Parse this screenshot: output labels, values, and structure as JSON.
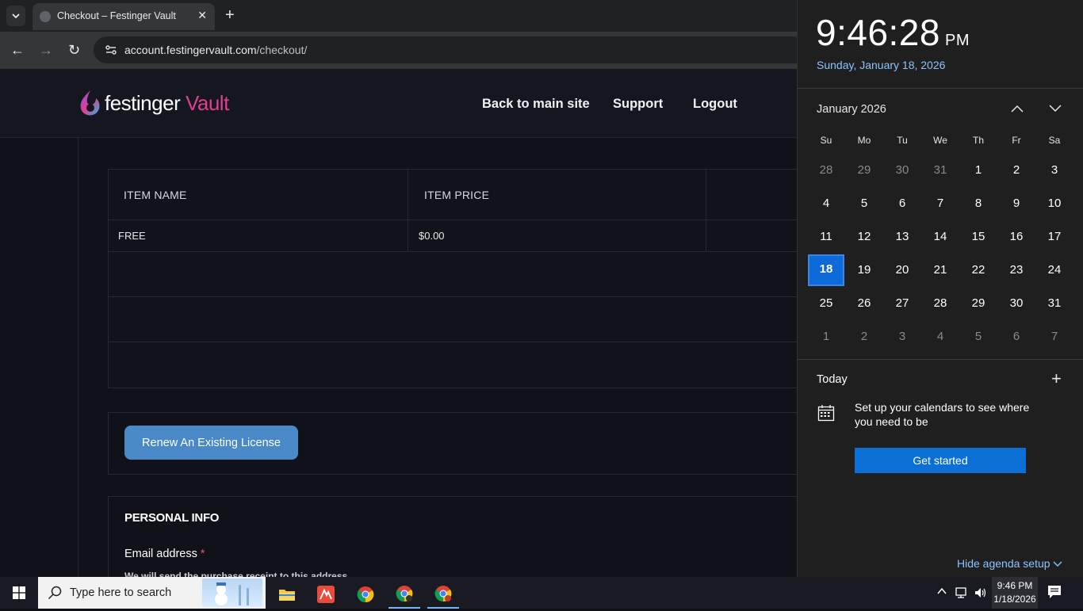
{
  "browser": {
    "tab_title": "Checkout – Festinger Vault",
    "url_host": "account.festingervault.com",
    "url_path": "/checkout/"
  },
  "site": {
    "logo_part1": "festinger",
    "logo_part2": "Vault",
    "nav": [
      "Back to main site",
      "Support",
      "Logout"
    ]
  },
  "orders": {
    "headers": [
      "ITEM NAME",
      "ITEM PRICE"
    ],
    "rows": [
      {
        "name": "FREE",
        "price": "$0.00"
      }
    ]
  },
  "renew_label": "Renew An Existing License",
  "personal": {
    "title": "PERSONAL INFO",
    "email_label": "Email address",
    "required_mark": "*",
    "email_help": "We will send the purchase receipt to this address."
  },
  "flyout": {
    "time": "9:46:28",
    "ampm": "PM",
    "full_date": "Sunday, January 18, 2026",
    "month_label": "January 2026",
    "weekdays": [
      "Su",
      "Mo",
      "Tu",
      "We",
      "Th",
      "Fr",
      "Sa"
    ],
    "weeks": [
      [
        "28",
        "29",
        "30",
        "31",
        "1",
        "2",
        "3"
      ],
      [
        "4",
        "5",
        "6",
        "7",
        "8",
        "9",
        "10"
      ],
      [
        "11",
        "12",
        "13",
        "14",
        "15",
        "16",
        "17"
      ],
      [
        "18",
        "19",
        "20",
        "21",
        "22",
        "23",
        "24"
      ],
      [
        "25",
        "26",
        "27",
        "28",
        "29",
        "30",
        "31"
      ],
      [
        "1",
        "2",
        "3",
        "4",
        "5",
        "6",
        "7"
      ]
    ],
    "today": "18",
    "today_label": "Today",
    "agenda_text": "Set up your calendars to see where you need to be",
    "get_started": "Get started",
    "hide_agenda": "Hide agenda setup"
  },
  "taskbar": {
    "search_placeholder": "Type here to search",
    "time": "9:46 PM",
    "date": "1/18/2026"
  },
  "colors": {
    "accent_blue": "#0b6fd6",
    "brand_pink": "#e23d8f",
    "renew_button": "#4a89c8"
  }
}
